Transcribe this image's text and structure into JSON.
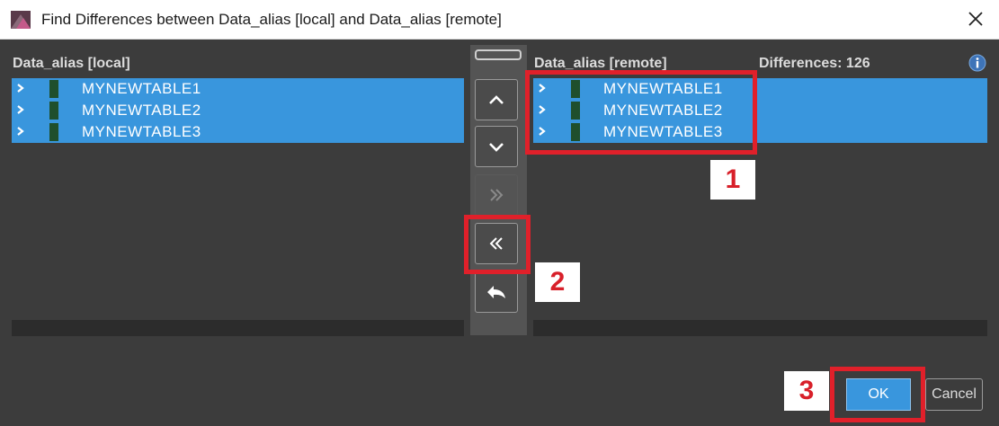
{
  "window": {
    "title": "Find Differences between Data_alias [local] and Data_alias [remote]",
    "app_icon": "app-logo-icon",
    "close_icon": "close-icon"
  },
  "local_panel": {
    "header": "Data_alias [local]",
    "items": [
      {
        "label": "MYNEWTABLE1",
        "selected": true
      },
      {
        "label": "MYNEWTABLE2",
        "selected": true
      },
      {
        "label": "MYNEWTABLE3",
        "selected": true
      }
    ]
  },
  "remote_panel": {
    "header": "Data_alias [remote]",
    "differences": "Differences: 126",
    "items": [
      {
        "label": "MYNEWTABLE1",
        "selected": true
      },
      {
        "label": "MYNEWTABLE2",
        "selected": true
      },
      {
        "label": "MYNEWTABLE3",
        "selected": true
      }
    ]
  },
  "toolbar": {
    "buttons": [
      {
        "icon": "chevron-up-icon",
        "enabled": true
      },
      {
        "icon": "chevron-down-icon",
        "enabled": true
      },
      {
        "icon": "double-chevron-right-icon",
        "enabled": false
      },
      {
        "icon": "double-chevron-left-icon",
        "enabled": true
      },
      {
        "icon": "undo-arrow-icon",
        "enabled": true
      }
    ]
  },
  "annotations": {
    "step1": "1",
    "step2": "2",
    "step3": "3",
    "highlight_color": "#e0202a"
  },
  "footer": {
    "ok_label": "OK",
    "cancel_label": "Cancel"
  },
  "colors": {
    "selection": "#3996dd",
    "background": "#3c3c3c",
    "item_marker": "#1f4f2c"
  }
}
